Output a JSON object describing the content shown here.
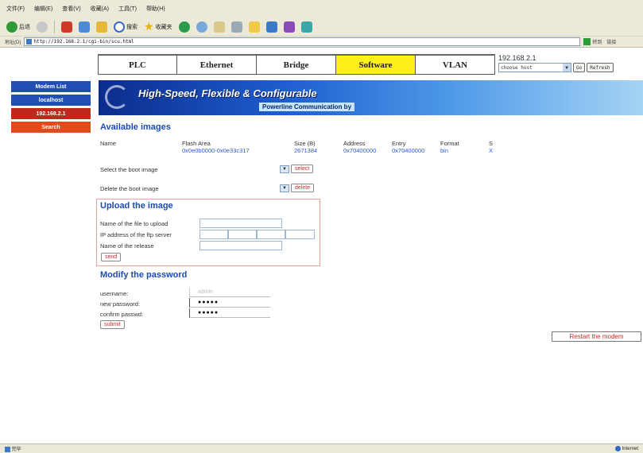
{
  "browser": {
    "menu": [
      "文件(F)",
      "编辑(E)",
      "查看(V)",
      "收藏(A)",
      "工具(T)",
      "帮助(H)"
    ],
    "toolbar": {
      "back": "后退",
      "search": "搜索",
      "favorites": "收藏夹"
    },
    "address_label": "地址(D)",
    "url": "http://192.168.2.1/cgi-bin/scu.html",
    "go_label": "转到",
    "links_label": "链接",
    "status_left": "完毕",
    "status_right": "Internet"
  },
  "tabs": [
    {
      "label": "PLC",
      "active": false
    },
    {
      "label": "Ethernet",
      "active": false
    },
    {
      "label": "Bridge",
      "active": false
    },
    {
      "label": "Software",
      "active": true
    },
    {
      "label": "VLAN",
      "active": false
    }
  ],
  "host": {
    "ip": "192.168.2.1",
    "select_placeholder": "choose host",
    "go_label": "Go",
    "refresh_label": "Refresh"
  },
  "sidebar": [
    {
      "label": "Modem List",
      "style": "blue"
    },
    {
      "label": "localhost",
      "style": "blue"
    },
    {
      "label": "192.168.2.1",
      "style": "red"
    },
    {
      "label": "Search",
      "style": "orange"
    }
  ],
  "banner": {
    "title": "High-Speed, Flexible & Configurable",
    "subtitle": "Powerline Communication by"
  },
  "images": {
    "title": "Available images",
    "headers": {
      "name": "Name",
      "flash": "Flash Area",
      "size": "Size (B)",
      "address": "Address",
      "entry": "Entry",
      "format": "Format",
      "s": "S"
    },
    "row": {
      "flash": "0x0e0b0000-0x0e33c317",
      "size": "2671384",
      "address": "0x70400000",
      "entry": "0x70400000",
      "format": "bin",
      "s": "X"
    },
    "boot_label": "Select the boot image",
    "select_label": "select",
    "delete_boot_label": "Delete the boot image",
    "delete_label": "delete"
  },
  "upload": {
    "title": "Upload the image",
    "file_label": "Name of the file to upload",
    "ftp_label": "IP address of the ftp server",
    "release_label": "Name of the release",
    "send_label": "send"
  },
  "password": {
    "title": "Modify the password",
    "username_label": "username:",
    "username_value": "admin",
    "new_label": "new password:",
    "new_value": "●●●●●",
    "confirm_label": "confirm passwd:",
    "confirm_value": "●●●●●",
    "submit_label": "submit"
  },
  "restart_label": "Restart the modem",
  "colors": {
    "accent_blue": "#1d4bb5",
    "tab_active": "#ffef1a",
    "link": "#2b5ad8",
    "button_text": "#d02828"
  }
}
